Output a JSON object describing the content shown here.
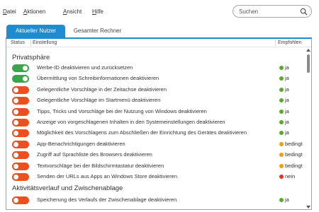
{
  "menu": [
    {
      "label": "Datei"
    },
    {
      "label": "Aktionen"
    },
    {
      "label": "Ansicht"
    },
    {
      "label": "Hilfe"
    }
  ],
  "search": {
    "placeholder": "Suchen",
    "icon": "search-icon"
  },
  "tabs": [
    {
      "label": "Aktueller Nutzer",
      "active": true
    },
    {
      "label": "Gesamter Rechner",
      "active": false
    }
  ],
  "columns": {
    "status": "Status",
    "setting": "Einstellung",
    "recommended": "Empfohlen"
  },
  "colors": {
    "accent": "#1e8cd0",
    "on": "#3aa54a",
    "off": "#ee4f1f",
    "ja": "#5aaa2a",
    "bedingt": "#f0a000",
    "nein": "#e8301c"
  },
  "sections": [
    {
      "title": "Privatsphäre",
      "rows": [
        {
          "label": "Werbe-ID deaktivieren und zurücksetzen",
          "on": true,
          "rec": "ja",
          "rec_color": "#5aaa2a"
        },
        {
          "label": "Übermittlung von Schreibinformationen deaktivieren",
          "on": true,
          "rec": "ja",
          "rec_color": "#5aaa2a"
        },
        {
          "label": "Gelegentliche Vorschläge in der Zeitachse deaktivieren",
          "on": false,
          "rec": "ja",
          "rec_color": "#5aaa2a"
        },
        {
          "label": "Gelegentliche Vorschläge im Startmenü deaktivieren",
          "on": false,
          "rec": "ja",
          "rec_color": "#5aaa2a"
        },
        {
          "label": "Tipps, Tricks und Vorschläge bei der Nutzung von Windows deaktivieren",
          "on": false,
          "rec": "ja",
          "rec_color": "#5aaa2a"
        },
        {
          "label": "Anzeige von vorgeschlagenen Inhalten in den Systemeinstellungen deaktivieren",
          "on": false,
          "rec": "ja",
          "rec_color": "#5aaa2a"
        },
        {
          "label": "Möglichkeit des Vorschlagens zum Abschließen der Einrichtung des Gerätes deaktivieren",
          "on": false,
          "rec": "ja",
          "rec_color": "#5aaa2a"
        },
        {
          "label": "App-Benachrichtigungen deaktivieren",
          "on": false,
          "rec": "bedingt",
          "rec_color": "#f0a000"
        },
        {
          "label": "Zugriff auf Sprachliste des Browsers deaktivieren",
          "on": false,
          "rec": "bedingt",
          "rec_color": "#f0a000"
        },
        {
          "label": "Textvorschläge bei der Bildschirmtastatur deaktivieren",
          "on": false,
          "rec": "bedingt",
          "rec_color": "#f0a000"
        },
        {
          "label": "Senden der URLs aus Apps an Windows Store deaktivieren",
          "on": false,
          "rec": "nein",
          "rec_color": "#e8301c"
        }
      ]
    },
    {
      "title": "Aktivitätsverlauf und Zwischenablage",
      "rows": [
        {
          "label": "Speicherung des Verlaufs der Zwischenablage deaktivieren",
          "on": false,
          "rec": "ja",
          "rec_color": "#5aaa2a"
        }
      ]
    }
  ]
}
